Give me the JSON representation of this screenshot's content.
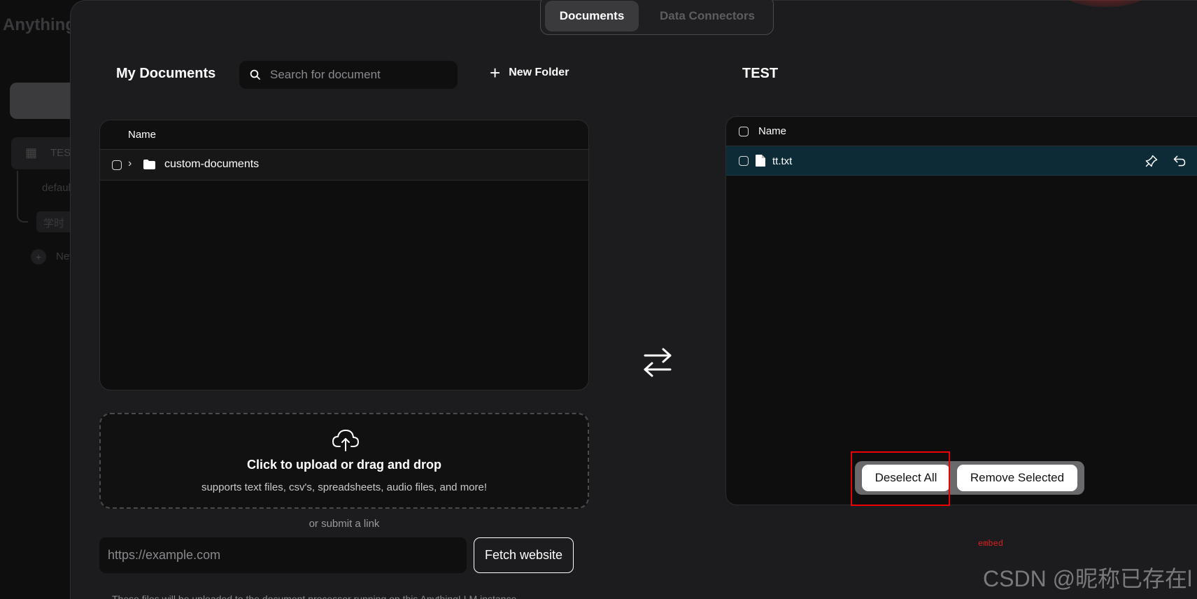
{
  "background": {
    "logo": "AnythingLLM",
    "workspace_label": "TEST",
    "thread_default": "default",
    "thread_item": "学时",
    "new_thread": "New"
  },
  "tabs": [
    {
      "label": "Documents",
      "active": true
    },
    {
      "label": "Data Connectors",
      "active": false
    }
  ],
  "left": {
    "title": "My Documents",
    "search_placeholder": "Search for document",
    "new_folder_label": "New Folder",
    "column_name": "Name",
    "rows": [
      {
        "name": "custom-documents",
        "type": "folder"
      }
    ]
  },
  "right": {
    "title": "TEST",
    "column_name": "Name",
    "rows": [
      {
        "name": "tt.txt",
        "type": "file",
        "selected": true
      }
    ],
    "deselect_label": "Deselect All",
    "remove_label": "Remove Selected"
  },
  "upload": {
    "title": "Click to upload or drag and drop",
    "subtitle": "supports text files, csv's, spreadsheets, audio files, and more!",
    "or_link": "or submit a link",
    "url_placeholder": "https://example.com",
    "fetch_label": "Fetch website",
    "footnote": "These files will be uploaded to the document processor running on this AnythingLLM instance."
  },
  "annotation": {
    "embed_note": "embed",
    "watermark": "CSDN @昵称已存在l"
  },
  "colors": {
    "selected_row": "#0d2b36",
    "highlight_box": "#ee0000"
  }
}
